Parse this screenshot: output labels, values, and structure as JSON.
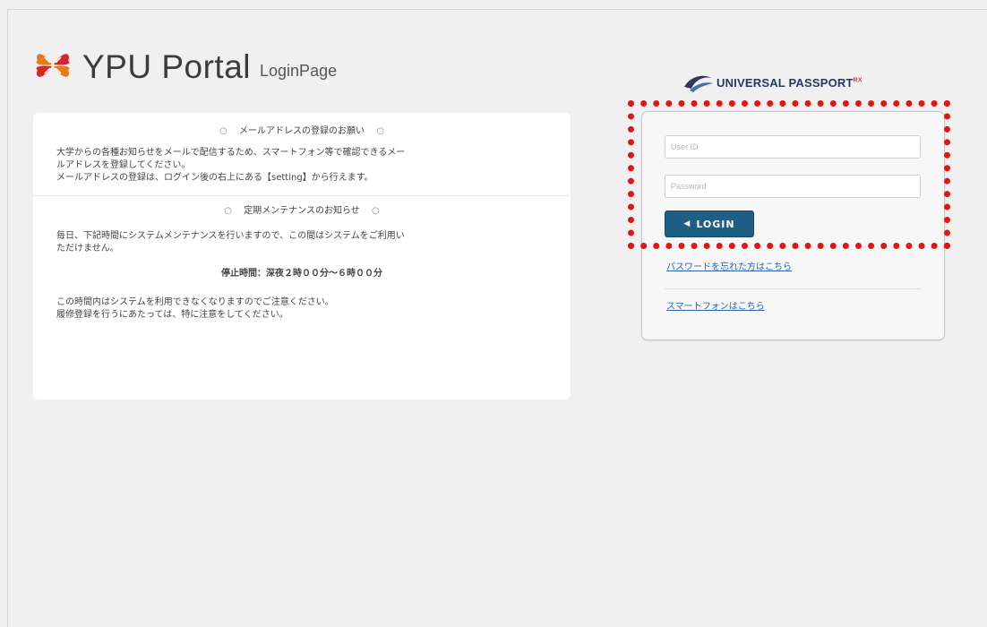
{
  "logo": {
    "title": "YPU Portal",
    "subtitle": "LoginPage",
    "icon": "ypu-flower-icon"
  },
  "notice": {
    "section1_heading": "メールアドレスの登録のお願い",
    "section1_line1": "大学からの各種お知らせをメールで配信するため、スマートフォン等で確認できるメー",
    "section1_line2": "ルアドレスを登録してください。",
    "section1_line3": "メールアドレスの登録は、ログイン後の右上にある【setting】から行えます。",
    "section2_heading": "定期メンテナンスのお知らせ",
    "section2_line1": "毎日、下記時間にシステムメンテナンスを行いますので、この間はシステムをご利用い",
    "section2_line2": "ただけません。",
    "stop_time": "停止時間：深夜２時００分～６時００分",
    "section2_line3": "この時間内はシステムを利用できなくなりますのでご注意ください。",
    "section2_line4": "履修登録を行うにあたっては、特に注意をしてください。",
    "heading_mark": "○"
  },
  "brand": {
    "name": "UNIVERSAL PASSPORT",
    "suffix": "RX",
    "icon": "universal-passport-swoosh-icon"
  },
  "login": {
    "user_placeholder": "User ID",
    "password_placeholder": "Password",
    "button_label": "LOGIN",
    "button_icon": "sign-in-icon",
    "forgot_link": "パスワードを忘れた方はこちら",
    "smartphone_link": "スマートフォンはこちら"
  },
  "colors": {
    "login_button": "#1f5f86",
    "link": "#2a66b0",
    "highlight": "#e41414"
  }
}
